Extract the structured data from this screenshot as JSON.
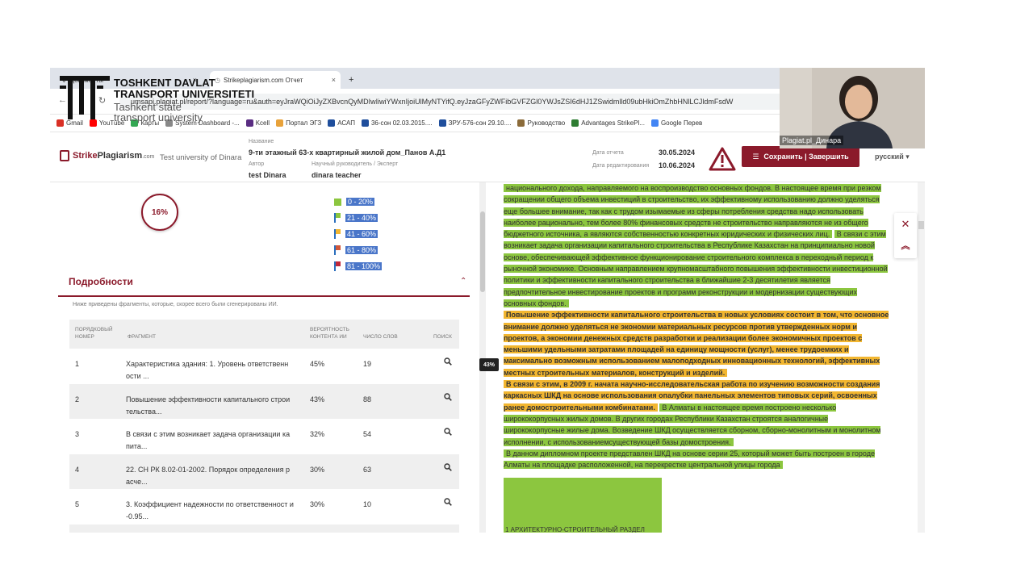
{
  "browser": {
    "tabs": [
      {
        "label": "Документы",
        "close": "×"
      },
      {
        "label": "Strikeplagiarism.com Отчет",
        "close": "×"
      }
    ],
    "new_tab": "+",
    "url": "umsapi.plagiat.pl/report/?language=ru&auth=eyJraWQiOiJyZXBvcnQyMDIwIiwiYWxnIjoiUlMyNTYifQ.eyJzaGFyZWFibGVFZGl0YWJsZSI6dHJ1ZSwidmlld09ubHkiOmZhbHNlLCJldmFsdW",
    "bookmarks": [
      {
        "label": "Gmail",
        "icon": "gmail-icon",
        "color": "#d93025"
      },
      {
        "label": "YouTube",
        "icon": "youtube-icon",
        "color": "#ff0000"
      },
      {
        "label": "Карты",
        "icon": "maps-icon",
        "color": "#34a853"
      },
      {
        "label": "System Dashboard -...",
        "icon": "dashboard-icon",
        "color": "#888888"
      },
      {
        "label": "Kcell",
        "icon": "kcell-icon",
        "color": "#5a2d82"
      },
      {
        "label": "Портал ЭГЗ",
        "icon": "portal-icon",
        "color": "#e8a23a"
      },
      {
        "label": "АСАП",
        "icon": "asap-icon",
        "color": "#1f4e9c"
      },
      {
        "label": "36-сон 02.03.2015....",
        "icon": "doc-icon",
        "color": "#1f4e9c"
      },
      {
        "label": "ЗРУ-576-сон 29.10....",
        "icon": "doc-icon",
        "color": "#1f4e9c"
      },
      {
        "label": "Руководство",
        "icon": "guide-icon",
        "color": "#8b6b3a"
      },
      {
        "label": "Advantages StrikePl...",
        "icon": "plus-icon",
        "color": "#2e7d32"
      },
      {
        "label": "Google Перев",
        "icon": "translate-icon",
        "color": "#4285f4"
      }
    ]
  },
  "header": {
    "logo_text_1": "Strike",
    "logo_text_2": "Plagiarism",
    "logo_text_3": ".com",
    "organization": "Test university of Dinara",
    "name_label": "Название",
    "name_value": "9-ти этажный 63-х квартирный жилой дом_Панов А.Д1",
    "author_label": "Автор",
    "author_value": "test Dinara",
    "supervisor_label": "Научный руководитель / Эксперт",
    "supervisor_value": "dinara teacher",
    "report_date_label": "Дата отчета",
    "report_date_value": "30.05.2024",
    "edit_date_label": "Дата редактирования",
    "edit_date_value": "10.06.2024",
    "save_button": "Сохранить | Завершить",
    "language": "русский ▾"
  },
  "summary": {
    "score": "16%",
    "legend": [
      {
        "label": "0 - 20%",
        "color": "#8cc63f"
      },
      {
        "label": "21 - 40%",
        "color": "#8cc63f"
      },
      {
        "label": "41 - 60%",
        "color": "#f2b630"
      },
      {
        "label": "61 - 80%",
        "color": "#d0573a"
      },
      {
        "label": "81 - 100%",
        "color": "#c0283a"
      }
    ]
  },
  "details": {
    "title": "Подробности",
    "note": "Ниже приведены фрагменты, которые, скорее всего были сгенерированы ИИ.",
    "columns": {
      "num": "ПОРЯДКОВЫЙ НОМЕР",
      "fragment": "ФРАГМЕНТ",
      "prob": "ВЕРОЯТНОСТЬ КОНТЕНТА ИИ",
      "words": "ЧИСЛО СЛОВ",
      "search": "ПОИСК"
    },
    "rows": [
      {
        "num": "1",
        "fragment": "Характеристика здания: 1. Уровень ответственн ости ...",
        "prob": "45%",
        "words": "19"
      },
      {
        "num": "2",
        "fragment": "Повышение эффективности капитального строи тельства...",
        "prob": "43%",
        "words": "88"
      },
      {
        "num": "3",
        "fragment": "В связи с этим возникает задача организации ка пита...",
        "prob": "32%",
        "words": "54"
      },
      {
        "num": "4",
        "fragment": "22. СН РК 8.02-01-2002. Порядок определения р асче...",
        "prob": "30%",
        "words": "63"
      },
      {
        "num": "5",
        "fragment": "3. Коэффициент надежности по ответственност и -0.95...",
        "prob": "30%",
        "words": "10"
      }
    ]
  },
  "badge": "43%",
  "document": {
    "p1": "национального дохода, направляемого на воспроизводство основных фондов. В настоящее время при резком сокращении общего объема инвестиций в строительство, их эффективному использованию должно уделяться еще большее внимание, так как с трудом изымаемые из сферы потребления средства надо использовать наиболее рационально, тем более 80% финансовых средств не строительство направляются не из общего бюджетного источника, а являются собственностью конкретных юридических и физических лиц.",
    "p2": "В связи с этим возникает задача организации капитального строительства в Республике Казахстан на принципиально новой основе, обеспечивающей эффективное функционирование строительного комплекса в переходный период к рыночной экономике. Основным направлением крупномасштабного повышения эффективности инвестиционной политики и эффективности капитального строительства в ближайшие 2-3 десятилетия является предпочтительное инвестирование проектов и программ реконструкции и модернизации существующих основных фондов.",
    "p3": "Повышение эффективности капитального строительства в новых условиях состоит в том, что основное внимание должно уделяться не экономии материальных ресурсов против утвержденных норм и проектов, а экономии денежных средств разработки и реализации более экономичных проектов с меньшими удельными затратами площадей на единицу мощности (услуг), менее трудоемких и максимально возможным использованием малоподходных инновационных технологий, эффективных местных строительных материалов, конструкций и изделий.",
    "p4": "В связи с этим, в 2009 г. начата научно-исследовательская работа по изучению возможности создания каркасных ШКД на основе использования опалубки панельных элементов типовых серий, освоенных ранее домостроительными комбинатами.",
    "p5": "В Алматы в настоящее время построено несколько ширококорпусных жилых домов. В других городах Республики Казахстан строятся аналогичные ширококорпусные жилые дома. Возведение ШКД осуществляется сборном, сборно-монолитным и монолитном исполнении, с использованиемсуществующей базы домостроения.",
    "p6": "В данном дипломном проекте представлен ШКД на основе серии 25, который может быть построен в городе Алматы на площадке расположенной, на перекрестке центральной улицы города",
    "p7": "1 АРХИТЕКТУРНО-СТРОИТЕЛЬНЫЙ РАЗДЕЛ"
  },
  "watermark": {
    "line1": "TOSHKENT DAVLAT",
    "line2": "TRANSPORT UNIVERSITETI",
    "line3": "Tashkent state",
    "line4": "transport university"
  },
  "webcam": {
    "name": "Plagiat.pl_Динара"
  }
}
